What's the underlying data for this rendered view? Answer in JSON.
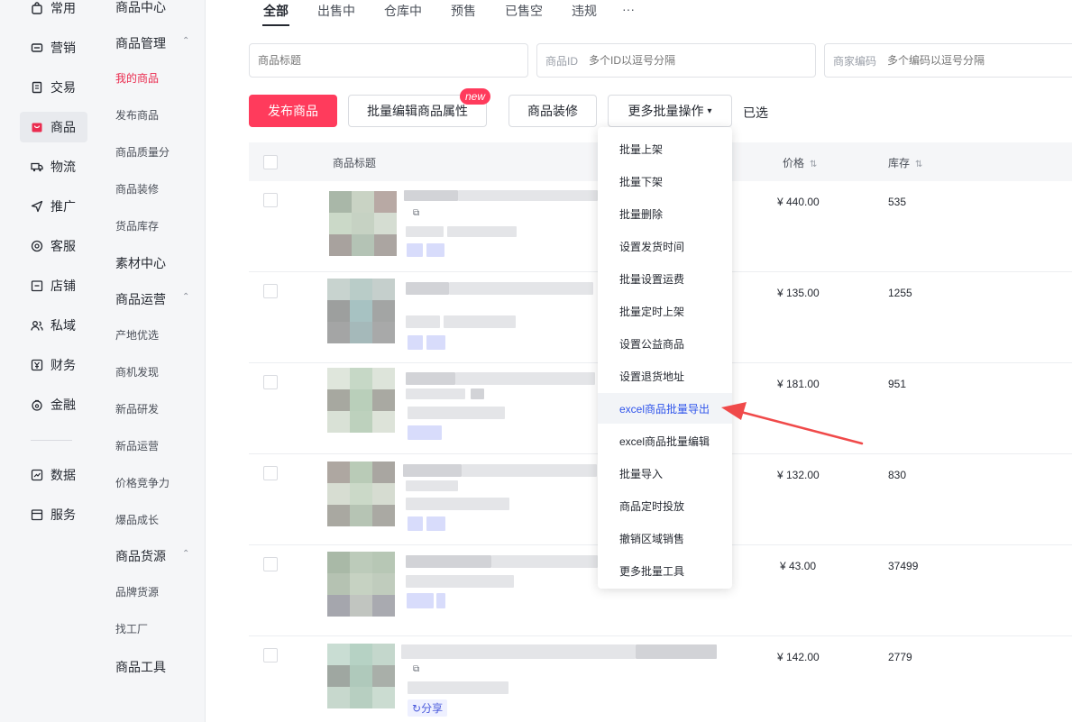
{
  "rail": {
    "items": [
      {
        "label": "常用",
        "icon": "bag-icon"
      },
      {
        "label": "营销",
        "icon": "ticket-icon"
      },
      {
        "label": "交易",
        "icon": "document-icon"
      },
      {
        "label": "商品",
        "icon": "shop-icon"
      },
      {
        "label": "物流",
        "icon": "truck-icon"
      },
      {
        "label": "推广",
        "icon": "send-icon"
      },
      {
        "label": "客服",
        "icon": "headset-icon"
      },
      {
        "label": "店铺",
        "icon": "store-icon"
      },
      {
        "label": "私域",
        "icon": "people-icon"
      },
      {
        "label": "财务",
        "icon": "yuan-icon"
      },
      {
        "label": "金融",
        "icon": "wallet-icon"
      },
      {
        "label": "数据",
        "icon": "chart-icon"
      },
      {
        "label": "服务",
        "icon": "service-icon"
      }
    ],
    "active": "商品"
  },
  "subnav": {
    "items": [
      {
        "label": "商品中心",
        "kind": "group"
      },
      {
        "label": "商品管理",
        "kind": "group",
        "expanded": true
      },
      {
        "label": "我的商品",
        "kind": "item",
        "active": true
      },
      {
        "label": "发布商品",
        "kind": "item"
      },
      {
        "label": "商品质量分",
        "kind": "item"
      },
      {
        "label": "商品装修",
        "kind": "item"
      },
      {
        "label": "货品库存",
        "kind": "item"
      },
      {
        "label": "素材中心",
        "kind": "group"
      },
      {
        "label": "商品运营",
        "kind": "group",
        "expanded": true
      },
      {
        "label": "产地优选",
        "kind": "item"
      },
      {
        "label": "商机发现",
        "kind": "item"
      },
      {
        "label": "新品研发",
        "kind": "item"
      },
      {
        "label": "新品运营",
        "kind": "item"
      },
      {
        "label": "价格竞争力",
        "kind": "item"
      },
      {
        "label": "爆品成长",
        "kind": "item"
      },
      {
        "label": "商品货源",
        "kind": "group",
        "expanded": true
      },
      {
        "label": "品牌货源",
        "kind": "item"
      },
      {
        "label": "找工厂",
        "kind": "item"
      },
      {
        "label": "商品工具",
        "kind": "group"
      }
    ]
  },
  "tabs": {
    "items": [
      "全部",
      "出售中",
      "仓库中",
      "预售",
      "已售空",
      "违规",
      "···"
    ],
    "active": "全部"
  },
  "filters": {
    "title_placeholder": "商品标题",
    "id_label": "商品ID",
    "id_placeholder": "多个ID以逗号分隔",
    "code_label": "商家编码",
    "code_placeholder": "多个编码以逗号分隔"
  },
  "actions": {
    "publish": "发布商品",
    "batch_edit": "批量编辑商品属性",
    "new_badge": "new",
    "decorate": "商品装修",
    "more_batch": "更多批量操作",
    "selected": "已选"
  },
  "table": {
    "headers": {
      "title": "商品标题",
      "price": "价格",
      "stock": "库存"
    },
    "rows": [
      {
        "price": "¥ 440.00",
        "stock": "535"
      },
      {
        "price": "¥ 135.00",
        "stock": "1255"
      },
      {
        "price": "¥ 181.00",
        "stock": "951"
      },
      {
        "price": "¥ 132.00",
        "stock": "830"
      },
      {
        "price": "¥ 43.00",
        "stock": "37499"
      },
      {
        "price": "¥ 142.00",
        "stock": "2779"
      }
    ],
    "share_label": "分享"
  },
  "dropdown": {
    "items": [
      "批量上架",
      "批量下架",
      "批量删除",
      "设置发货时间",
      "批量设置运费",
      "批量定时上架",
      "设置公益商品",
      "设置退货地址",
      "excel商品批量导出",
      "excel商品批量编辑",
      "批量导入",
      "商品定时投放",
      "撤销区域销售",
      "更多批量工具"
    ],
    "highlighted": "excel商品批量导出"
  },
  "colors": {
    "brand": "#ff3b5c",
    "active_nav": "#ea2c4f",
    "highlight_text": "#2f54eb",
    "annotation_arrow": "#f04a4a"
  }
}
